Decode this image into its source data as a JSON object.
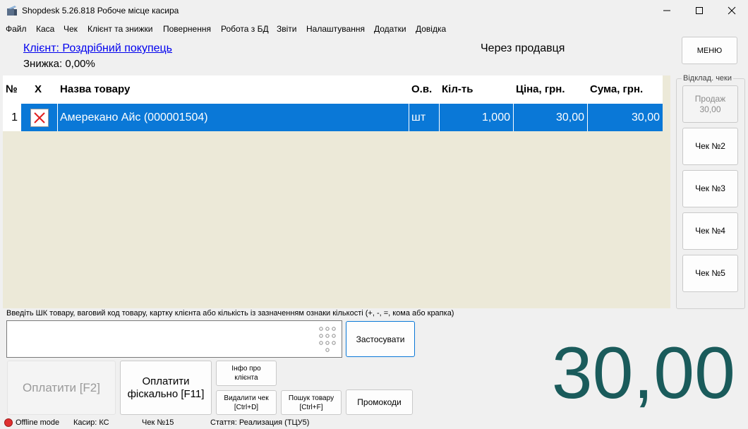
{
  "window": {
    "title": "Shopdesk 5.26.818 Робоче місце касира"
  },
  "menu": [
    {
      "label": "Файл"
    },
    {
      "label": "Каса"
    },
    {
      "label": "Чек"
    },
    {
      "label": "Клієнт та знижки"
    },
    {
      "label": "Повернення"
    },
    {
      "label": "Робота з БД"
    },
    {
      "label": "Звіти"
    },
    {
      "label": "Налаштування"
    },
    {
      "label": "Додатки"
    },
    {
      "label": "Довідка"
    }
  ],
  "header": {
    "client_link": "Клієнт: Роздрібний покупець",
    "discount": "Знижка: 0,00%",
    "sale_mode": "Через продавця",
    "menu_button": "МЕНЮ"
  },
  "table": {
    "columns": {
      "num": "№",
      "del": "Х",
      "name": "Назва товару",
      "unit": "О.в.",
      "qty": "Кіл-ть",
      "price": "Ціна, грн.",
      "sum": "Сума, грн."
    },
    "rows": [
      {
        "num": "1",
        "name": "Амерекано Айс (000001504)",
        "unit": "шт",
        "qty": "1,000",
        "price": "30,00",
        "sum": "30,00"
      }
    ]
  },
  "held_checks": {
    "label": "Відклад. чеки",
    "buttons": [
      {
        "line1": "Продаж",
        "line2": "30,00",
        "enabled": false
      },
      {
        "line1": "Чек №2",
        "line2": "",
        "enabled": true
      },
      {
        "line1": "Чек №3",
        "line2": "",
        "enabled": true
      },
      {
        "line1": "Чек №4",
        "line2": "",
        "enabled": true
      },
      {
        "line1": "Чек №5",
        "line2": "",
        "enabled": true
      }
    ]
  },
  "input": {
    "hint": "Введіть ШК товару, ваговий код товару,  картку клієнта або кількість із зазначенням ознаки кількості (+, -, =, кома або крапка)",
    "value": "",
    "apply_button": "Застосувати"
  },
  "buttons": {
    "pay": "Оплатити [F2]",
    "fiscal_line1": "Оплатити",
    "fiscal_line2": "фіскально [F11]",
    "client_info_line1": "Інфо про",
    "client_info_line2": "клієнта",
    "delete_check_line1": "Видалити чек",
    "delete_check_line2": "[Ctrl+D]",
    "search_line1": "Пошук товару",
    "search_line2": "[Ctrl+F]",
    "promo": "Промокоди"
  },
  "total": "30,00",
  "status": {
    "mode": "Offline mode",
    "cashier": "Касир: КС",
    "check": "Чек №15",
    "article": "Стаття: Реализация (ТЦУ5)"
  },
  "colors": {
    "selection": "#0a78d7",
    "total": "#1a5b5b",
    "link": "#0000ee",
    "table_bg": "#ece9d8",
    "offline_dot": "#e03030"
  },
  "icons": {
    "app": "app-icon",
    "delete_row": "delete-x-icon",
    "keypad": "keypad-icon",
    "offline": "status-dot-icon"
  }
}
